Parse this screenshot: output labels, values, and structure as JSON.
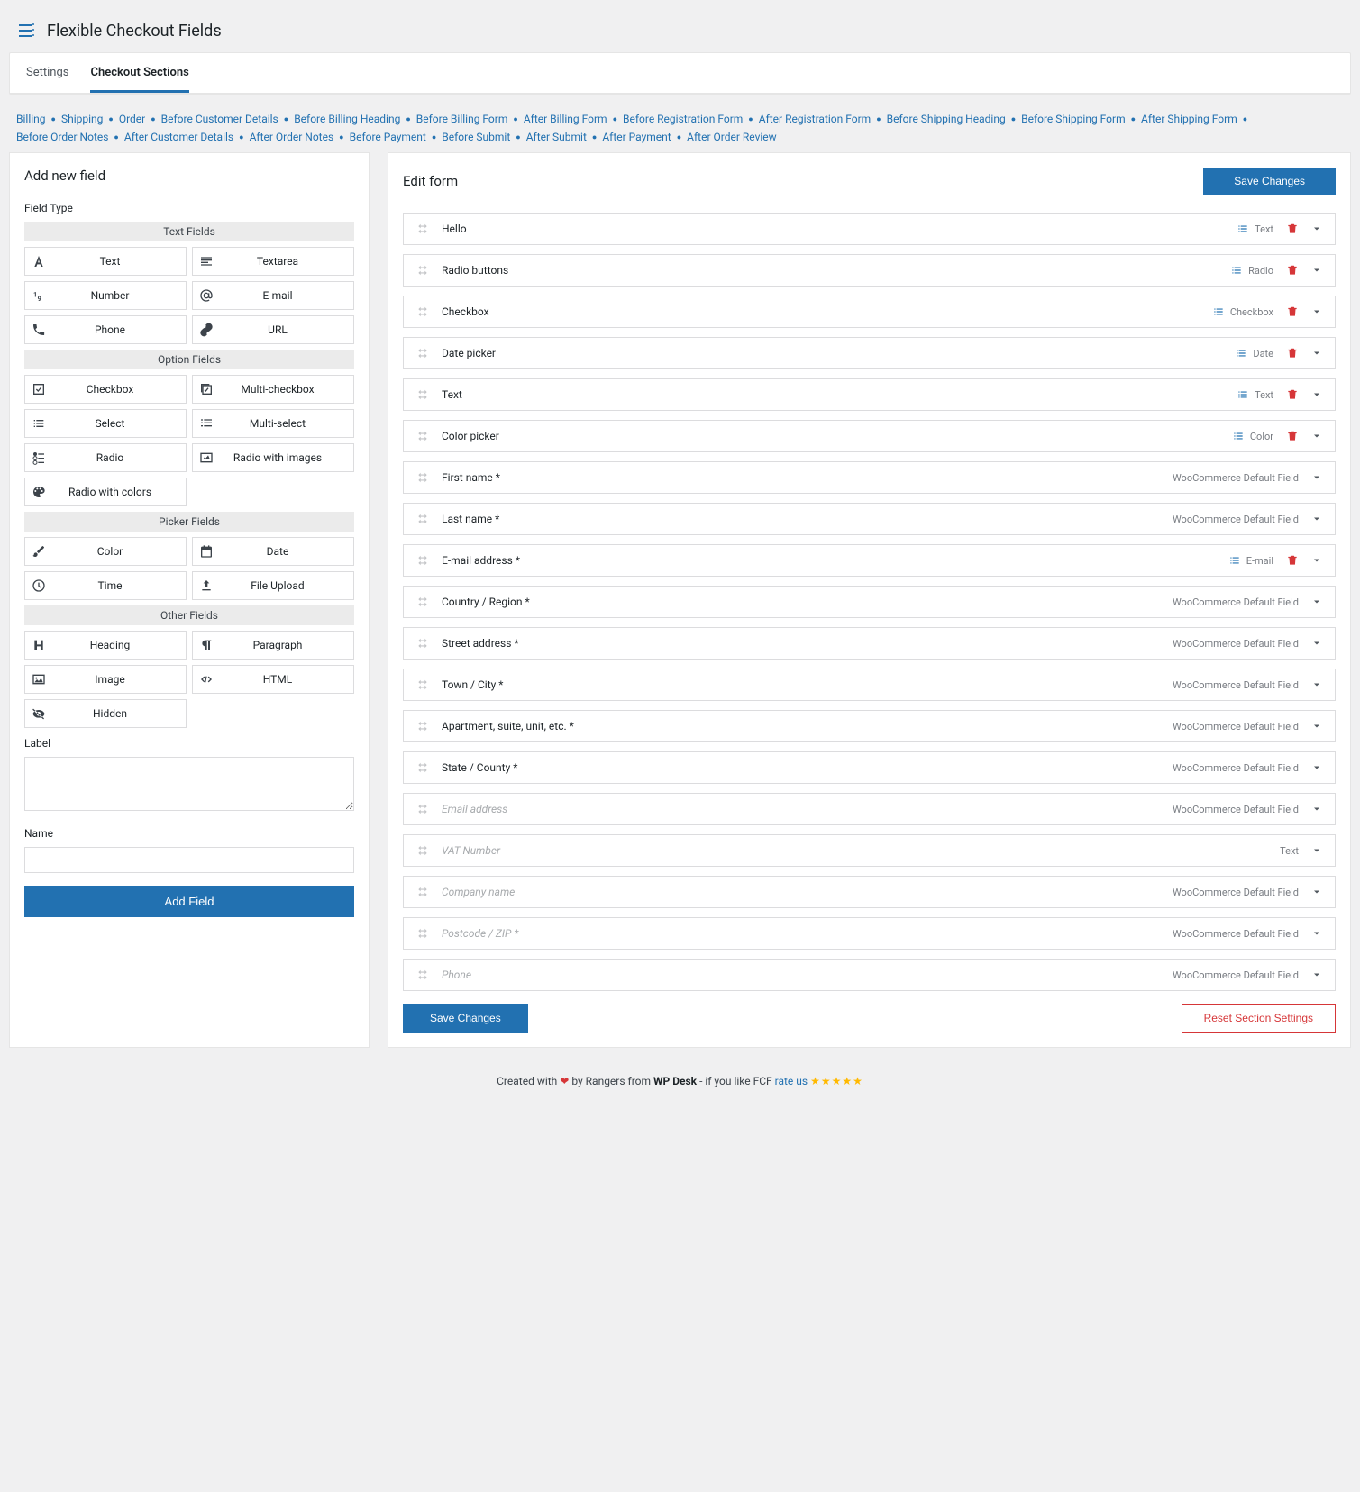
{
  "header": {
    "title": "Flexible Checkout Fields"
  },
  "tabs": [
    {
      "label": "Settings",
      "active": false
    },
    {
      "label": "Checkout Sections",
      "active": true
    }
  ],
  "nav_links": [
    "Billing",
    "Shipping",
    "Order",
    "Before Customer Details",
    "Before Billing Heading",
    "Before Billing Form",
    "After Billing Form",
    "Before Registration Form",
    "After Registration Form",
    "Before Shipping Heading",
    "Before Shipping Form",
    "After Shipping Form",
    "Before Order Notes",
    "After Customer Details",
    "After Order Notes",
    "Before Payment",
    "Before Submit",
    "After Submit",
    "After Payment",
    "After Order Review"
  ],
  "left": {
    "title": "Add new field",
    "field_type_label": "Field Type",
    "groups": [
      {
        "header": "Text Fields",
        "items": [
          {
            "icon": "font",
            "label": "Text"
          },
          {
            "icon": "textarea",
            "label": "Textarea"
          },
          {
            "icon": "number",
            "label": "Number"
          },
          {
            "icon": "at",
            "label": "E-mail"
          },
          {
            "icon": "phone",
            "label": "Phone"
          },
          {
            "icon": "link",
            "label": "URL"
          }
        ]
      },
      {
        "header": "Option Fields",
        "items": [
          {
            "icon": "checkbox",
            "label": "Checkbox"
          },
          {
            "icon": "multicheck",
            "label": "Multi-checkbox"
          },
          {
            "icon": "select",
            "label": "Select"
          },
          {
            "icon": "multiselect",
            "label": "Multi-select"
          },
          {
            "icon": "radio",
            "label": "Radio"
          },
          {
            "icon": "radioimg",
            "label": "Radio with images"
          },
          {
            "icon": "palette",
            "label": "Radio with colors"
          }
        ]
      },
      {
        "header": "Picker Fields",
        "items": [
          {
            "icon": "brush",
            "label": "Color"
          },
          {
            "icon": "calendar",
            "label": "Date"
          },
          {
            "icon": "clock",
            "label": "Time"
          },
          {
            "icon": "upload",
            "label": "File Upload"
          }
        ]
      },
      {
        "header": "Other Fields",
        "items": [
          {
            "icon": "heading",
            "label": "Heading"
          },
          {
            "icon": "paragraph",
            "label": "Paragraph"
          },
          {
            "icon": "image",
            "label": "Image"
          },
          {
            "icon": "code",
            "label": "HTML"
          },
          {
            "icon": "hidden",
            "label": "Hidden"
          }
        ]
      }
    ],
    "label_label": "Label",
    "name_label": "Name",
    "add_button": "Add Field"
  },
  "right": {
    "title": "Edit form",
    "save_button": "Save Changes",
    "reset_button": "Reset Section Settings",
    "fields": [
      {
        "name": "Hello",
        "type": "Text",
        "has_type_icon": true,
        "deletable": true,
        "disabled": false
      },
      {
        "name": "Radio buttons",
        "type": "Radio",
        "has_type_icon": true,
        "deletable": true,
        "disabled": false
      },
      {
        "name": "Checkbox",
        "type": "Checkbox",
        "has_type_icon": true,
        "deletable": true,
        "disabled": false
      },
      {
        "name": "Date picker",
        "type": "Date",
        "has_type_icon": true,
        "deletable": true,
        "disabled": false
      },
      {
        "name": "Text",
        "type": "Text",
        "has_type_icon": true,
        "deletable": true,
        "disabled": false
      },
      {
        "name": "Color picker",
        "type": "Color",
        "has_type_icon": true,
        "deletable": true,
        "disabled": false
      },
      {
        "name": "First name *",
        "type": "WooCommerce Default Field",
        "has_type_icon": false,
        "deletable": false,
        "disabled": false
      },
      {
        "name": "Last name *",
        "type": "WooCommerce Default Field",
        "has_type_icon": false,
        "deletable": false,
        "disabled": false
      },
      {
        "name": "E-mail address *",
        "type": "E-mail",
        "has_type_icon": true,
        "deletable": true,
        "disabled": false
      },
      {
        "name": "Country / Region *",
        "type": "WooCommerce Default Field",
        "has_type_icon": false,
        "deletable": false,
        "disabled": false
      },
      {
        "name": "Street address *",
        "type": "WooCommerce Default Field",
        "has_type_icon": false,
        "deletable": false,
        "disabled": false
      },
      {
        "name": "Town / City *",
        "type": "WooCommerce Default Field",
        "has_type_icon": false,
        "deletable": false,
        "disabled": false
      },
      {
        "name": "Apartment, suite, unit, etc. *",
        "type": "WooCommerce Default Field",
        "has_type_icon": false,
        "deletable": false,
        "disabled": false
      },
      {
        "name": "State / County *",
        "type": "WooCommerce Default Field",
        "has_type_icon": false,
        "deletable": false,
        "disabled": false
      },
      {
        "name": "Email address",
        "type": "WooCommerce Default Field",
        "has_type_icon": false,
        "deletable": false,
        "disabled": true
      },
      {
        "name": "VAT Number",
        "type": "Text",
        "has_type_icon": false,
        "deletable": false,
        "disabled": true
      },
      {
        "name": "Company name",
        "type": "WooCommerce Default Field",
        "has_type_icon": false,
        "deletable": false,
        "disabled": true
      },
      {
        "name": "Postcode / ZIP *",
        "type": "WooCommerce Default Field",
        "has_type_icon": false,
        "deletable": false,
        "disabled": true
      },
      {
        "name": "Phone",
        "type": "WooCommerce Default Field",
        "has_type_icon": false,
        "deletable": false,
        "disabled": true
      }
    ]
  },
  "footer": {
    "prefix": "Created with ",
    "mid1": " by Rangers from ",
    "brand": "WP Desk",
    "mid2": " - if you like FCF ",
    "rate": "rate us"
  }
}
